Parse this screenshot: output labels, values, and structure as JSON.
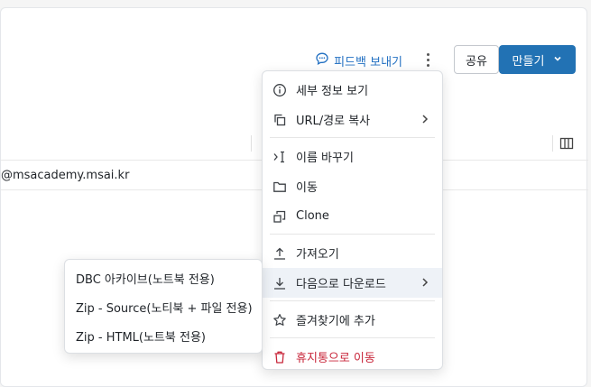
{
  "toolbar": {
    "feedback_label": "피드백 보내기",
    "share_label": "공유",
    "create_label": "만들기"
  },
  "table": {
    "email_cell": "@msacademy.msai.kr"
  },
  "menu": {
    "items": [
      {
        "label": "세부 정보 보기",
        "icon": "info-icon"
      },
      {
        "label": "URL/경로 복사",
        "icon": "copy-icon",
        "has_submenu": true
      },
      {
        "label": "이름 바꾸기",
        "icon": "rename-icon"
      },
      {
        "label": "이동",
        "icon": "folder-icon"
      },
      {
        "label": "Clone",
        "icon": "clone-icon"
      },
      {
        "label": "가져오기",
        "icon": "upload-icon"
      },
      {
        "label": "다음으로 다운로드",
        "icon": "download-icon",
        "has_submenu": true,
        "active": true
      },
      {
        "label": "즐겨찾기에 추가",
        "icon": "star-icon"
      },
      {
        "label": "휴지통으로 이동",
        "icon": "trash-icon",
        "danger": true
      }
    ]
  },
  "submenu": {
    "items": [
      {
        "label": "DBC 아카이브(노트북 전용)"
      },
      {
        "label": "Zip - Source(노티북 + 파일 전용)"
      },
      {
        "label": "Zip - HTML(노트북 전용)"
      }
    ]
  },
  "colors": {
    "primary": "#2272b4",
    "link": "#2270c2",
    "danger": "#c8263a",
    "active_bg": "#eef2f7"
  }
}
